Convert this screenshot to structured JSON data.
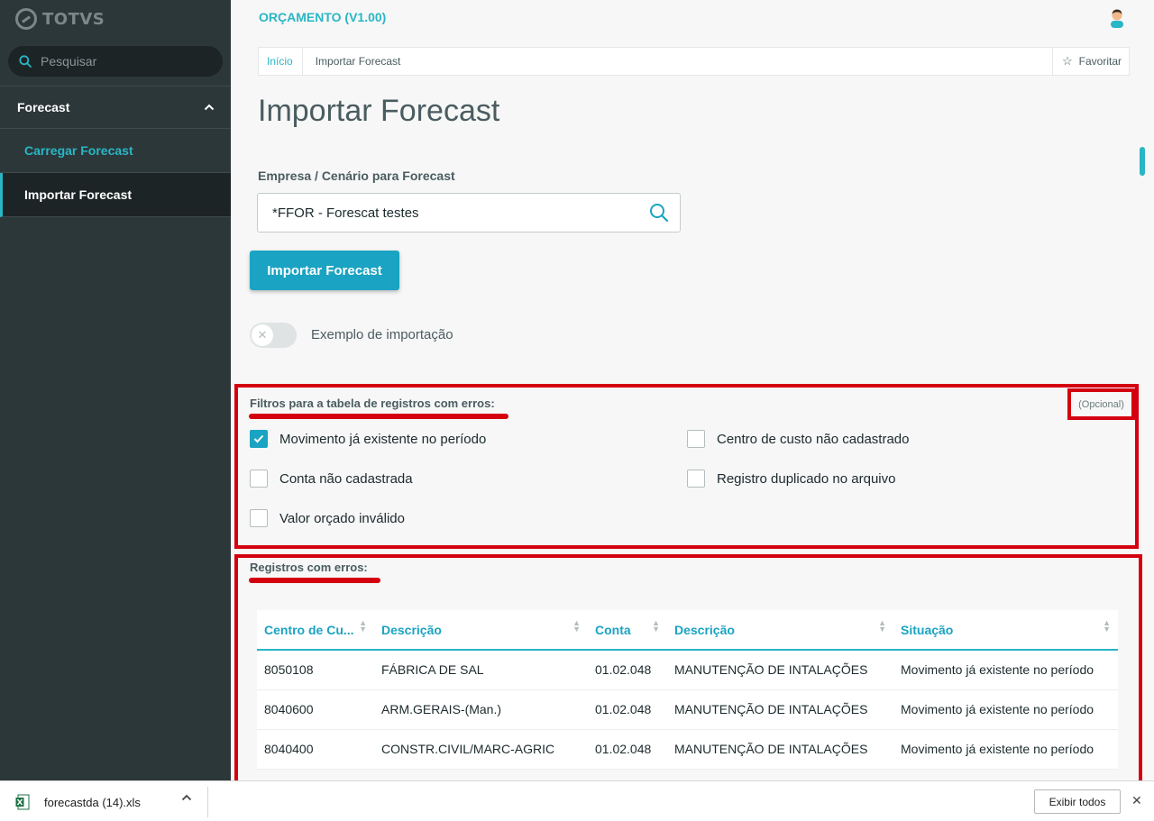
{
  "brand": {
    "logo_text": "TOTVS",
    "accent": "#29b6c5",
    "primary": "#1aa3c2",
    "highlight": "#d40010"
  },
  "sidebar": {
    "search_placeholder": "Pesquisar",
    "group_label": "Forecast",
    "items": [
      {
        "label": "Carregar Forecast"
      },
      {
        "label": "Importar Forecast"
      }
    ]
  },
  "header": {
    "app_title": "ORÇAMENTO (V1.00)"
  },
  "breadcrumb": {
    "home": "Início",
    "current": "Importar Forecast",
    "favorite": "Favoritar"
  },
  "page": {
    "title": "Importar Forecast",
    "field_label": "Empresa / Cenário para Forecast",
    "field_value": "*FFOR - Forescat testes",
    "import_button": "Importar Forecast",
    "toggle_label": "Exemplo de importação",
    "toggle_on": false
  },
  "filters": {
    "title": "Filtros para a tabela de registros com erros:",
    "optional": "(Opcional)",
    "options": [
      {
        "label": "Movimento já existente no período",
        "checked": true
      },
      {
        "label": "Centro de custo não cadastrado",
        "checked": false
      },
      {
        "label": "Conta não cadastrada",
        "checked": false
      },
      {
        "label": "Registro duplicado no arquivo",
        "checked": false
      },
      {
        "label": "Valor orçado inválido",
        "checked": false
      }
    ]
  },
  "errors": {
    "title": "Registros com erros:",
    "columns": [
      "Centro de Cu...",
      "Descrição",
      "Conta",
      "Descrição",
      "Situação"
    ],
    "rows": [
      [
        "8050108",
        "FÁBRICA DE SAL",
        "01.02.048",
        "MANUTENÇÃO DE INTALAÇÕES",
        "Movimento já existente no período"
      ],
      [
        "8040600",
        "ARM.GERAIS-(Man.)",
        "01.02.048",
        "MANUTENÇÃO DE INTALAÇÕES",
        "Movimento já existente no período"
      ],
      [
        "8040400",
        "CONSTR.CIVIL/MARC-AGRIC",
        "01.02.048",
        "MANUTENÇÃO DE INTALAÇÕES",
        "Movimento já existente no período"
      ]
    ]
  },
  "download_bar": {
    "file_name": "forecastda (14).xls",
    "show_all": "Exibir todos",
    "close": "✕"
  },
  "icons": [
    "search-icon",
    "chevron-up-icon",
    "user-avatar-icon",
    "star-icon",
    "close-icon",
    "check-icon",
    "sort-icon",
    "excel-file-icon",
    "chevron-up-icon"
  ]
}
